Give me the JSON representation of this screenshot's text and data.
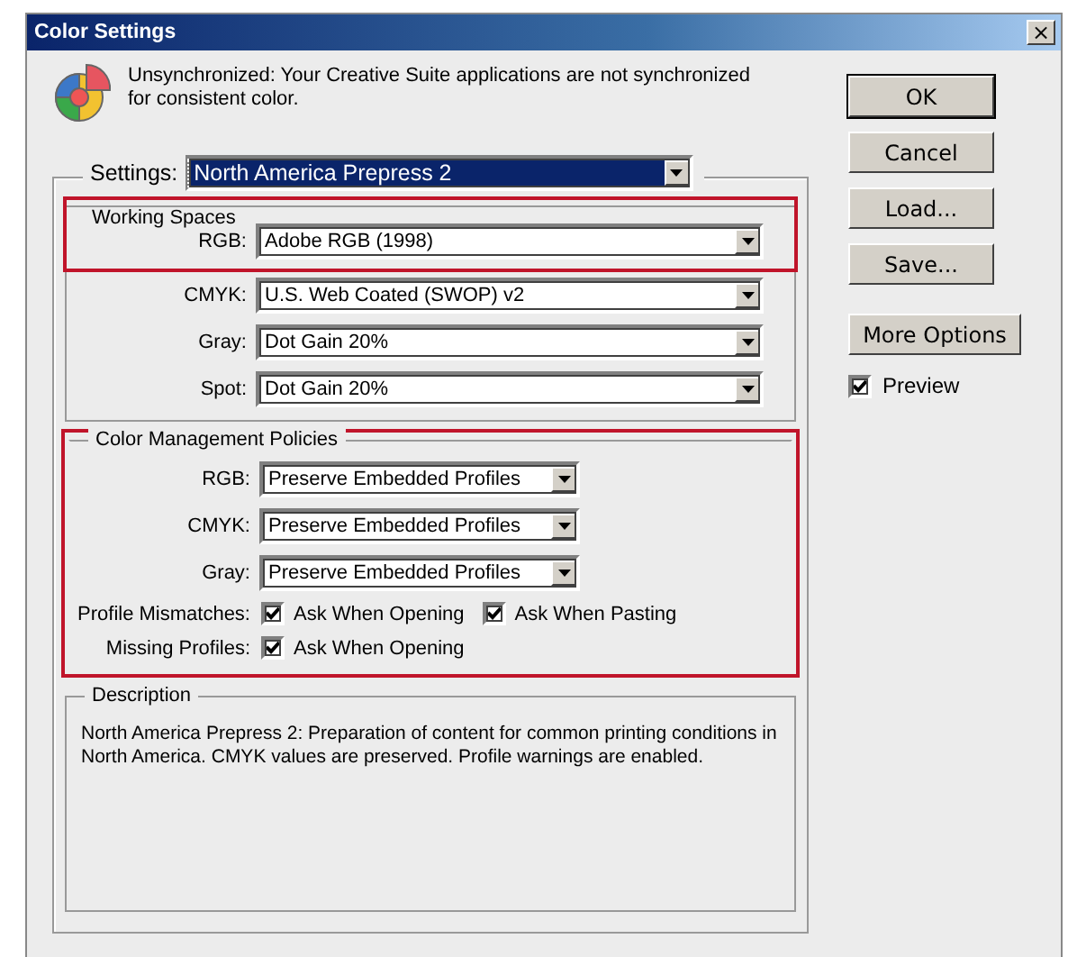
{
  "window": {
    "title": "Color Settings",
    "close": "×"
  },
  "sync_message": "Unsynchronized: Your Creative Suite applications are not synchronized for consistent color.",
  "settings": {
    "label": "Settings:",
    "value": "North America Prepress 2",
    "focused": true
  },
  "working_spaces": {
    "title": "Working Spaces",
    "rows": [
      {
        "label": "RGB:",
        "value": "Adobe RGB (1998)",
        "highlighted": true
      },
      {
        "label": "CMYK:",
        "value": "U.S. Web Coated (SWOP) v2",
        "highlighted": false
      },
      {
        "label": "Gray:",
        "value": "Dot Gain 20%",
        "highlighted": false
      },
      {
        "label": "Spot:",
        "value": "Dot Gain 20%",
        "highlighted": false
      }
    ]
  },
  "policies": {
    "title": "Color Management Policies",
    "highlighted": true,
    "rows": [
      {
        "label": "RGB:",
        "value": "Preserve Embedded Profiles"
      },
      {
        "label": "CMYK:",
        "value": "Preserve Embedded Profiles"
      },
      {
        "label": "Gray:",
        "value": "Preserve Embedded Profiles"
      }
    ],
    "checks": [
      {
        "label": "Profile Mismatches:",
        "options": [
          {
            "label": "Ask When Opening",
            "checked": true
          },
          {
            "label": "Ask When Pasting",
            "checked": true
          }
        ]
      },
      {
        "label": "Missing Profiles:",
        "options": [
          {
            "label": "Ask When Opening",
            "checked": true
          }
        ]
      }
    ]
  },
  "description": {
    "title": "Description",
    "text": "North America Prepress 2:  Preparation of content for common printing conditions in North America. CMYK values are preserved. Profile warnings are enabled."
  },
  "buttons": [
    {
      "label": "OK",
      "default": true
    },
    {
      "label": "Cancel",
      "default": false
    },
    {
      "label": "Load...",
      "default": false
    },
    {
      "label": "Save...",
      "default": false
    },
    {
      "label": "More Options",
      "default": false
    }
  ],
  "preview": {
    "label": "Preview",
    "checked": true
  }
}
